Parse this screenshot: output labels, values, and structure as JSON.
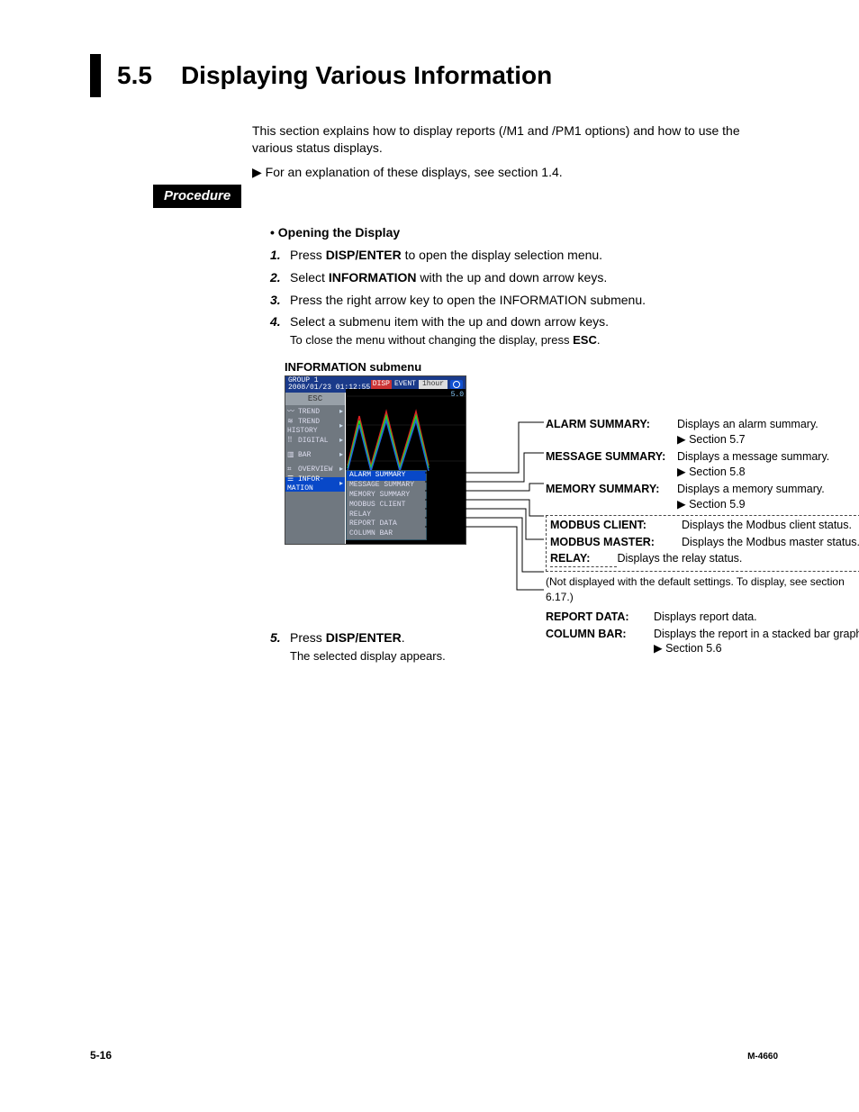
{
  "section": {
    "number": "5.5",
    "title": "Displaying Various Information"
  },
  "intro": "This section explains how to display reports (/M1 and /PM1 options) and how to use the various status displays.",
  "xref": "For an explanation of these displays, see section 1.4.",
  "procedure_label": "Procedure",
  "subhead_bullet": "•  Opening the Display",
  "steps": {
    "s1": {
      "n": "1.",
      "pre": "Press ",
      "b": "DISP/ENTER",
      "post": " to open the display selection menu."
    },
    "s2": {
      "n": "2.",
      "pre": "Select ",
      "b": "INFORMATION",
      "post": "  with the up and down arrow keys."
    },
    "s3": {
      "n": "3.",
      "t": "Press the right arrow key to open the INFORMATION submenu."
    },
    "s4": {
      "n": "4.",
      "t": "Select a submenu item with the up and down arrow keys.",
      "sub_pre": "To close the menu without changing the display, press ",
      "sub_b": "ESC",
      "sub_post": "."
    },
    "s5": {
      "n": "5.",
      "pre": "Press ",
      "b": "DISP/ENTER",
      "post": ".",
      "sub": "The selected display appears."
    }
  },
  "submenu_caption": "INFORMATION submenu",
  "device": {
    "group": "GROUP 1",
    "datetime": "2008/01/23 01:12:55",
    "badge": "DISP",
    "event": "EVENT",
    "interval": "1hour",
    "esc": "ESC",
    "side": [
      "TREND",
      "TREND HISTORY",
      "DIGITAL",
      "BAR",
      "OVERVIEW",
      "INFOR-\nMATION"
    ],
    "submenu": [
      "ALARM SUMMARY",
      "MESSAGE SUMMARY",
      "MEMORY SUMMARY",
      "MODBUS CLIENT",
      "RELAY",
      "REPORT DATA",
      "COLUMN BAR"
    ],
    "scale": "5.0"
  },
  "desc": {
    "alarm": {
      "k": "ALARM SUMMARY:",
      "v": "Displays an alarm summary.",
      "x": "▶ Section 5.7"
    },
    "message": {
      "k": "MESSAGE SUMMARY:",
      "v": "Displays a message summary.",
      "x": "▶ Section 5.8"
    },
    "memory": {
      "k": "MEMORY SUMMARY:",
      "v": "Displays a memory summary.",
      "x": "▶ Section 5.9"
    },
    "modbusc": {
      "k": "MODBUS CLIENT:",
      "v": "Displays the Modbus client status."
    },
    "modbusm": {
      "k": "MODBUS MASTER:",
      "v": "Displays the Modbus master status."
    },
    "relay": {
      "k": "RELAY:",
      "v": "Displays the relay status."
    },
    "note": "(Not displayed with the default settings. To display, see section 6.17.)",
    "report": {
      "k": "REPORT DATA:",
      "v": "Displays report data."
    },
    "column": {
      "k": "COLUMN BAR:",
      "v": "Displays the report in a stacked bar graph.",
      "x": "▶ Section 5.6"
    }
  },
  "footer": {
    "left": "5-16",
    "right": "M-4660"
  }
}
